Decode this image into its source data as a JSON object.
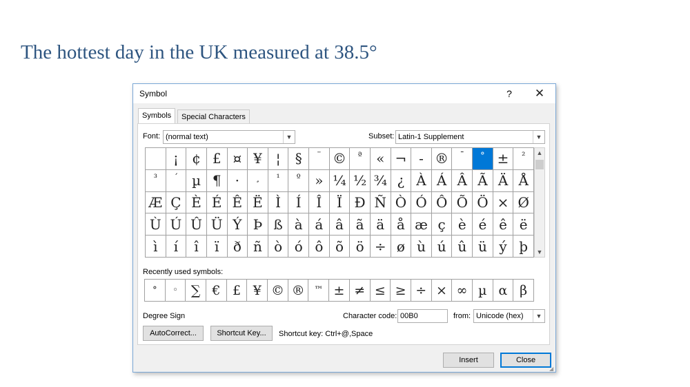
{
  "heading": "The hottest day in the UK measured at 38.5°",
  "dialog": {
    "title": "Symbol",
    "help": "?",
    "close": "✕",
    "tabs": [
      "Symbols",
      "Special Characters"
    ],
    "font_label": "Font:",
    "font_value": "(normal text)",
    "subset_label": "Subset:",
    "subset_value": "Latin-1 Supplement",
    "selected_symbol": "°",
    "symbols": [
      [
        "",
        "¡",
        "¢",
        "£",
        "¤",
        "¥",
        "¦",
        "§",
        "¨",
        "©",
        "ª",
        "«",
        "¬",
        "-",
        "®",
        "¯",
        "°",
        "±",
        "²"
      ],
      [
        "³",
        "´",
        "µ",
        "¶",
        "·",
        "¸",
        "¹",
        "º",
        "»",
        "¼",
        "½",
        "¾",
        "¿",
        "À",
        "Á",
        "Â",
        "Ã",
        "Ä",
        "Å"
      ],
      [
        "Æ",
        "Ç",
        "È",
        "É",
        "Ê",
        "Ë",
        "Ì",
        "Í",
        "Î",
        "Ï",
        "Ð",
        "Ñ",
        "Ò",
        "Ó",
        "Ô",
        "Õ",
        "Ö",
        "×",
        "Ø"
      ],
      [
        "Ù",
        "Ú",
        "Û",
        "Ü",
        "Ý",
        "Þ",
        "ß",
        "à",
        "á",
        "â",
        "ã",
        "ä",
        "å",
        "æ",
        "ç",
        "è",
        "é",
        "ê",
        "ë"
      ],
      [
        "ì",
        "í",
        "î",
        "ï",
        "ð",
        "ñ",
        "ò",
        "ó",
        "ô",
        "õ",
        "ö",
        "÷",
        "ø",
        "ù",
        "ú",
        "û",
        "ü",
        "ý",
        "þ"
      ]
    ],
    "recent_label": "Recently used symbols:",
    "recent": [
      "°",
      "◦",
      "∑",
      "€",
      "£",
      "¥",
      "©",
      "®",
      "™",
      "±",
      "≠",
      "≤",
      "≥",
      "÷",
      "×",
      "∞",
      "µ",
      "α",
      "β"
    ],
    "char_name": "Degree Sign",
    "char_code_label": "Character code:",
    "char_code": "00B0",
    "from_label": "from:",
    "from_value": "Unicode (hex)",
    "autocorrect": "AutoCorrect...",
    "shortcut_key_btn": "Shortcut Key...",
    "shortcut_text": "Shortcut key: Ctrl+@,Space",
    "insert": "Insert",
    "close_btn": "Close"
  },
  "colors": {
    "heading": "#2e5580",
    "selection": "#0078d7"
  }
}
